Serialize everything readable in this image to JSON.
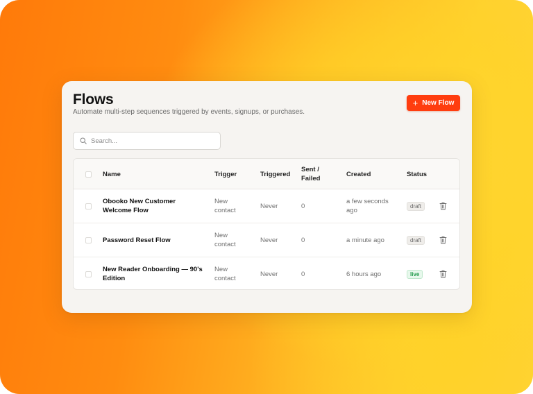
{
  "page": {
    "title": "Flows",
    "subtitle": "Automate multi-step sequences triggered by events, signups, or purchases."
  },
  "toolbar": {
    "new_flow_label": "New Flow",
    "search_placeholder": "Search..."
  },
  "table": {
    "headers": {
      "name": "Name",
      "trigger": "Trigger",
      "triggered": "Triggered",
      "sent_failed_1": "Sent /",
      "sent_failed_2": "Failed",
      "created": "Created",
      "status": "Status"
    },
    "rows": [
      {
        "name_1": "Obooko New Customer",
        "name_2": "Welcome Flow",
        "trigger_1": "New",
        "trigger_2": "contact",
        "triggered": "Never",
        "sent_failed": "0",
        "created_1": "a few seconds",
        "created_2": "ago",
        "status": "draft"
      },
      {
        "name_1": "Password Reset Flow",
        "name_2": "",
        "trigger_1": "New",
        "trigger_2": "contact",
        "triggered": "Never",
        "sent_failed": "0",
        "created_1": "a minute ago",
        "created_2": "",
        "status": "draft"
      },
      {
        "name_1": "New Reader Onboarding — 90's",
        "name_2": "Edition",
        "trigger_1": "New",
        "trigger_2": "contact",
        "triggered": "Never",
        "sent_failed": "0",
        "created_1": "6 hours ago",
        "created_2": "",
        "status": "live"
      }
    ]
  },
  "colors": {
    "accent": "#ff3d0f",
    "live": "#1f9a4a"
  }
}
